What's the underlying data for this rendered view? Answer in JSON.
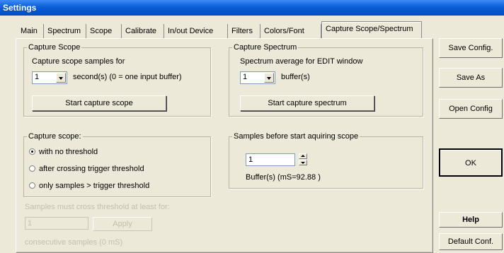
{
  "window": {
    "title": "Settings"
  },
  "tabs": [
    {
      "label": "Main"
    },
    {
      "label": "Spectrum"
    },
    {
      "label": "Scope"
    },
    {
      "label": "Calibrate"
    },
    {
      "label": "In/out Device"
    },
    {
      "label": "Filters"
    },
    {
      "label": "Colors/Font"
    },
    {
      "label": "Capture Scope/Spectrum"
    }
  ],
  "capture_scope": {
    "legend": "Capture Scope",
    "prompt": "Capture scope samples for",
    "combo_value": "1",
    "unit_label": "second(s) (0 = one input buffer)",
    "button": "Start capture scope"
  },
  "capture_spectrum": {
    "legend": "Capture Spectrum",
    "prompt": "Spectrum average for EDIT window",
    "combo_value": "1",
    "unit_label": "buffer(s)",
    "button": "Start capture spectrum"
  },
  "threshold": {
    "legend": "Capture scope:",
    "options": [
      {
        "label": "with no threshold",
        "checked": true
      },
      {
        "label": "after crossing trigger threshold",
        "checked": false
      },
      {
        "label": "only samples > trigger threshold",
        "checked": false
      }
    ]
  },
  "samples_before": {
    "legend": "Samples before start aquiring scope",
    "value": "1",
    "info": "Buffer(s) (mS=92.88 )"
  },
  "cross": {
    "label": "Samples must cross threshold at least for:",
    "value": "1",
    "apply": "Apply",
    "note": "consecutive samples (0 mS)"
  },
  "side": {
    "save_config": "Save Config.",
    "save_as": "Save As",
    "open_config": "Open Config",
    "ok": "OK",
    "help": "Help",
    "default_conf": "Default Conf."
  }
}
